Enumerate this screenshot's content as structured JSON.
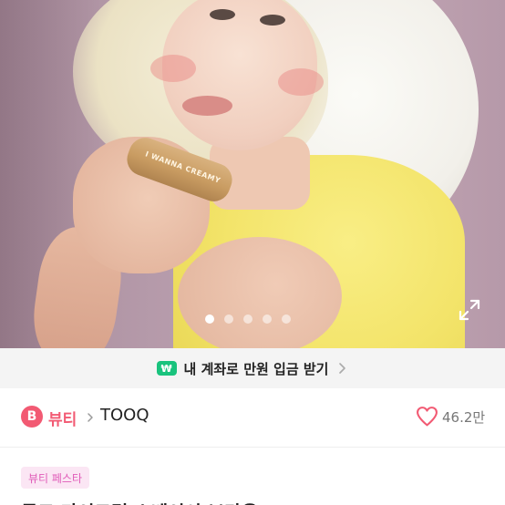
{
  "hero": {
    "product_text": "I WANNA CREAMY",
    "slide_count": 5,
    "active_slide": 1,
    "expand_icon": "expand-icon"
  },
  "promo": {
    "badge": "₩",
    "text": "내 계좌로 만원 입금 받기",
    "icon": "chevron-right-icon",
    "badge_color": "#19c37d"
  },
  "category": {
    "badge": "B",
    "name": "뷰티",
    "separator_icon": "chevron-right-icon",
    "brand": "TOOQ",
    "accent_color": "#f25a73"
  },
  "likes": {
    "icon": "heart-icon",
    "count": "46.2만"
  },
  "tag": {
    "label": "뷰티 페스타",
    "color": "#e05bb8"
  },
  "title": "투크 마이크림 스베이시 브라운"
}
